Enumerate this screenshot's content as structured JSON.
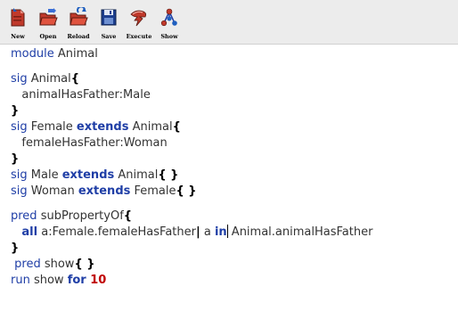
{
  "toolbar": {
    "buttons": [
      {
        "label": "New",
        "icon": "new-file-icon"
      },
      {
        "label": "Open",
        "icon": "open-folder-icon"
      },
      {
        "label": "Reload",
        "icon": "reload-folder-icon"
      },
      {
        "label": "Save",
        "icon": "save-floppy-icon"
      },
      {
        "label": "Execute",
        "icon": "execute-lightning-icon"
      },
      {
        "label": "Show",
        "icon": "show-graph-icon"
      }
    ]
  },
  "editor": {
    "l1": {
      "kw": "module",
      "t": " Animal"
    },
    "l2": {
      "kw": "sig",
      "name": " Animal",
      "brace": "{"
    },
    "l3": {
      "t": "   animalHasFather:Male"
    },
    "l4": {
      "brace": "}"
    },
    "l5": {
      "kw": "sig",
      "name": " Female ",
      "kw2": "extends",
      "name2": " Animal",
      "brace": "{"
    },
    "l6": {
      "t": "   femaleHasFather:Woman"
    },
    "l7": {
      "brace": "}"
    },
    "l8": {
      "kw": "sig",
      "name": " Male ",
      "kw2": "extends",
      "name2": " Animal",
      "brace": "{ }"
    },
    "l9": {
      "kw": "sig",
      "name": " Woman ",
      "kw2": "extends",
      "name2": " Female",
      "brace": "{ }"
    },
    "l10": {
      "kw": "pred",
      "name": " subPropertyOf",
      "brace": "{"
    },
    "l11": {
      "indent": "   ",
      "kw": "all",
      "t1": " a:Female.femaleHasFather",
      "bar": "|",
      "t2": " a ",
      "kw2": "in",
      "t3": " Animal.animalHasFather"
    },
    "l12": {
      "brace": "}"
    },
    "l13": {
      "indent": " ",
      "kw": "pred",
      "name": " show",
      "brace": "{ }"
    },
    "l14": {
      "kw": "run",
      "name": " show ",
      "kw2": "for",
      "num": " 10"
    }
  }
}
